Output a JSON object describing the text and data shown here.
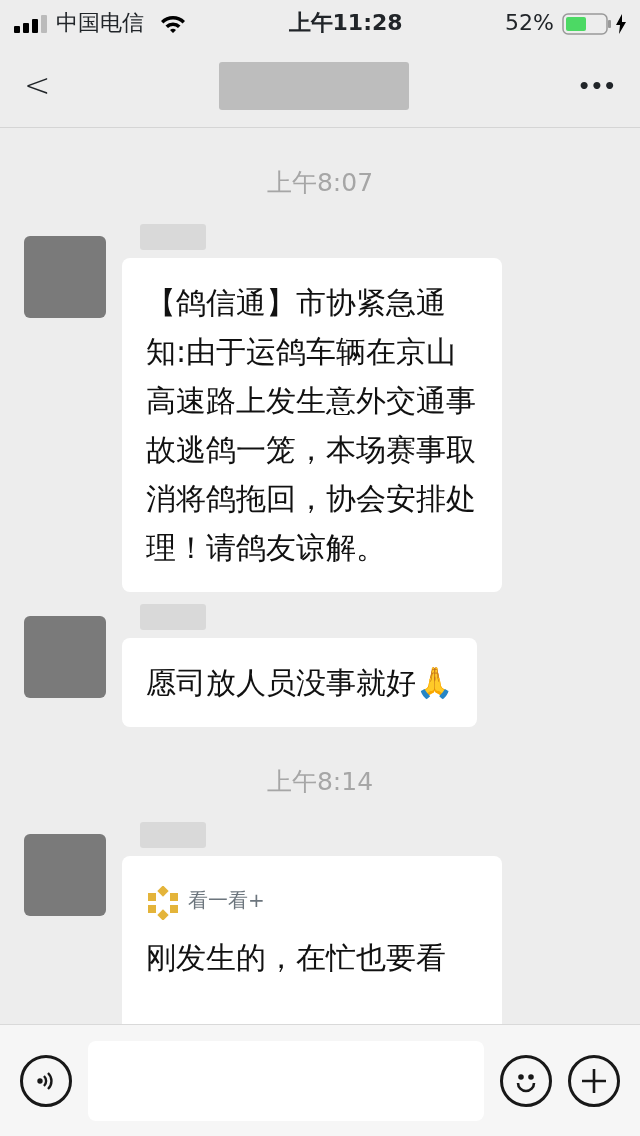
{
  "status_bar": {
    "carrier": "中国电信",
    "time": "上午11:28",
    "battery": "52%",
    "charging": true
  },
  "nav": {
    "back": "<",
    "more": "•••"
  },
  "messages": [
    {
      "kind": "time",
      "text": "上午8:07"
    },
    {
      "kind": "text",
      "text": "【鸽信通】市协紧急通知:由于运鸽车辆在京山高速路上发生意外交通事故逃鸽一笼，本场赛事取消将鸽拖回，协会安排处理！请鸽友谅解。"
    },
    {
      "kind": "text",
      "text": "愿司放人员没事就好🙏"
    },
    {
      "kind": "time",
      "text": "上午8:14"
    },
    {
      "kind": "card",
      "source": "看一看+",
      "text": "刚发生的，在忙也要看"
    }
  ]
}
